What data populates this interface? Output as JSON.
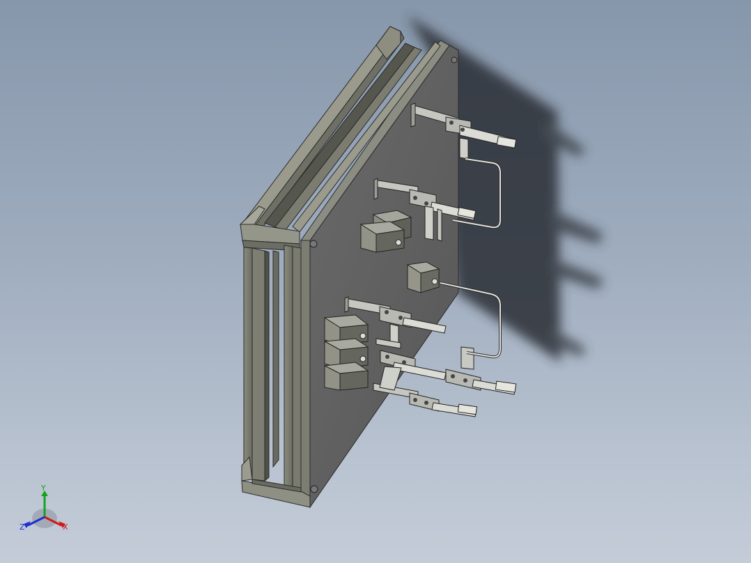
{
  "viewport": {
    "background_top": "#8797ab",
    "background_bottom": "#c4ccd8",
    "part_colors": {
      "plate_face": "#616161",
      "frame_face": "#7e7f72",
      "frame_dark": "#5a5b52",
      "metal_light": "#c9c9c4",
      "shadow": "#2b2f35"
    }
  },
  "triad": {
    "x_label": "X",
    "y_label": "Y",
    "z_label": "Z",
    "x_color": "#d01818",
    "y_color": "#12a31a",
    "z_color": "#1c2fd0"
  }
}
